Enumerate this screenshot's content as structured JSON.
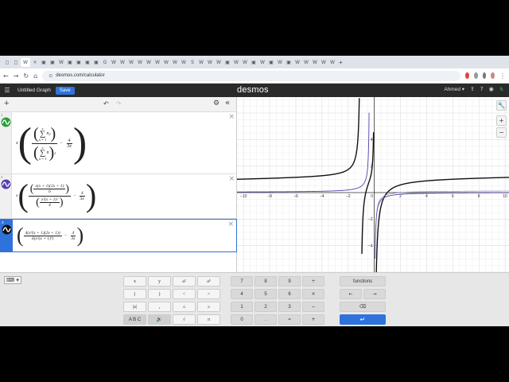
{
  "browser": {
    "url": "desmos.com/calculator",
    "tab_glyphs": [
      "◻",
      "◻",
      "W",
      "×",
      "▣",
      "▣",
      "W",
      "▣",
      "▣",
      "▣",
      "▣",
      "G",
      "W",
      "W",
      "W",
      "W",
      "W",
      "W",
      "W",
      "W",
      "W",
      "S",
      "W",
      "W",
      "W",
      "▣",
      "W",
      "W",
      "▣",
      "W",
      "▣",
      "W",
      "▣",
      "W",
      "W",
      "W",
      "W",
      "W"
    ]
  },
  "header": {
    "title": "Untitled Graph",
    "save_label": "Save",
    "logo": "desmos",
    "user": "Ahmed ▾"
  },
  "expressions": [
    {
      "index": "1",
      "color": "#2d9e3d",
      "lead": "x",
      "sum_top": "x",
      "sum_bottom": "n = 1",
      "num_term": "n",
      "num_power": "2",
      "den_term": "n",
      "den_power": "2",
      "minus": "−",
      "sub_num": "4",
      "sub_den": "3x"
    },
    {
      "index": "2",
      "color": "#5a3fb0",
      "lead": "x",
      "n_num": "x(x + 1)(2x + 1)",
      "n_den": "6",
      "d_num": "x²(x + 1)²",
      "d_den": "4",
      "minus": "−",
      "sub_num": "4",
      "sub_den": "3x"
    },
    {
      "index": "3",
      "color": "#111111",
      "num": "4(x³(x + 1)(2x + 1))",
      "den": "6(x²(x + 1)²)",
      "minus": "−",
      "sub_num": "4",
      "sub_den": "3x"
    }
  ],
  "graph": {
    "x_ticks": [
      "−10",
      "−8",
      "−6",
      "−4",
      "−2",
      "0",
      "2",
      "4",
      "6",
      "8",
      "10"
    ],
    "y_ticks": [
      "4",
      "2",
      "−2",
      "−4"
    ]
  },
  "keypad": {
    "left": [
      [
        "x",
        "y",
        "a²",
        "aᵇ"
      ],
      [
        "(",
        ")",
        "<",
        ">"
      ],
      [
        "|a|",
        ",",
        "≤",
        "≥"
      ],
      [
        "A B C",
        "🔊",
        "√",
        "π"
      ]
    ],
    "mid": [
      [
        "7",
        "8",
        "9",
        "÷"
      ],
      [
        "4",
        "5",
        "6",
        "×"
      ],
      [
        "1",
        "2",
        "3",
        "−"
      ],
      [
        "0",
        ".",
        "=",
        "+"
      ]
    ],
    "functions_label": "functions",
    "arrow_left": "←",
    "arrow_right": "→",
    "backspace": "⌫",
    "enter": "↵"
  }
}
